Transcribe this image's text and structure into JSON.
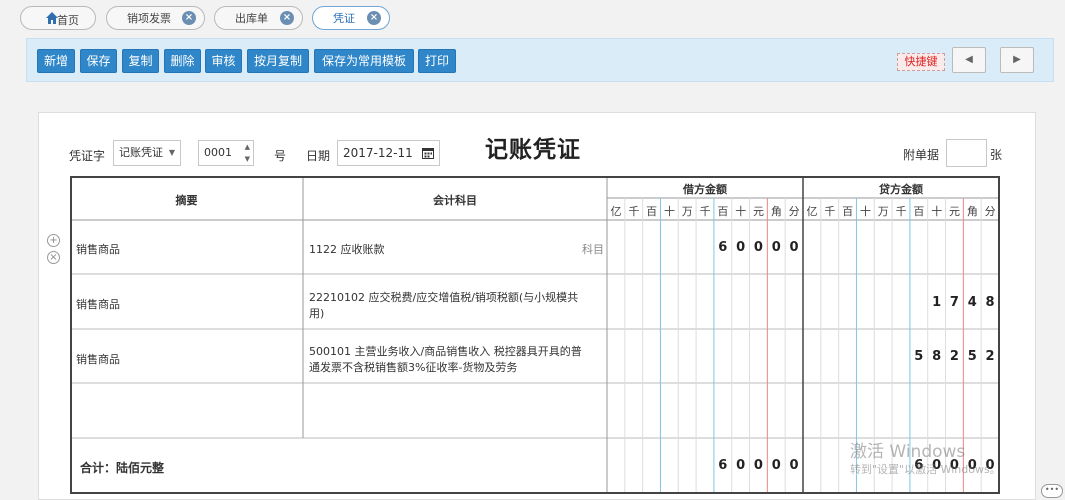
{
  "tabs": [
    {
      "label": "首页"
    },
    {
      "label": "销项发票"
    },
    {
      "label": "出库单"
    },
    {
      "label": "凭证"
    }
  ],
  "toolbar": {
    "buttons": [
      "新增",
      "保存",
      "复制",
      "删除",
      "审核",
      "按月复制",
      "保存为常用模板",
      "打印"
    ],
    "shortcut": "快捷键",
    "prev": "◀",
    "next": "▶"
  },
  "voucher": {
    "word_label": "凭证字",
    "word_value": "记账凭证",
    "number": "0001",
    "number_suffix": "号",
    "date_label": "日期",
    "date": "2017-12-11",
    "title": "记账凭证",
    "attach_label": "附单据",
    "attach_unit": "张",
    "columns": {
      "summary": "摘要",
      "account": "会计科目",
      "debit": "借方金额",
      "credit": "贷方金额"
    },
    "units": [
      "亿",
      "千",
      "百",
      "十",
      "万",
      "千",
      "百",
      "十",
      "元",
      "角",
      "分"
    ],
    "account_link": "科目",
    "rows": [
      {
        "summary": "销售商品",
        "account_line1": "1122 应收账款",
        "account_line2": "",
        "debit": "60000",
        "credit": ""
      },
      {
        "summary": "销售商品",
        "account_line1": "22210102 应交税费/应交增值税/销项税额(与小规模共",
        "account_line2": "用)",
        "debit": "",
        "credit": "1748"
      },
      {
        "summary": "销售商品",
        "account_line1": "500101 主营业务收入/商品销售收入 税控器具开具的普",
        "account_line2": "通发票不含税销售额3%征收率-货物及劳务",
        "debit": "",
        "credit": "58252"
      },
      {
        "summary": "",
        "account_line1": "",
        "account_line2": "",
        "debit": "",
        "credit": ""
      }
    ],
    "total_label": "合计：陆佰元整",
    "total_debit": "60000",
    "total_credit": "60000"
  },
  "watermark": {
    "line1": "激活 Windows",
    "line2": "转到\"设置\"以激活 Windows。"
  }
}
